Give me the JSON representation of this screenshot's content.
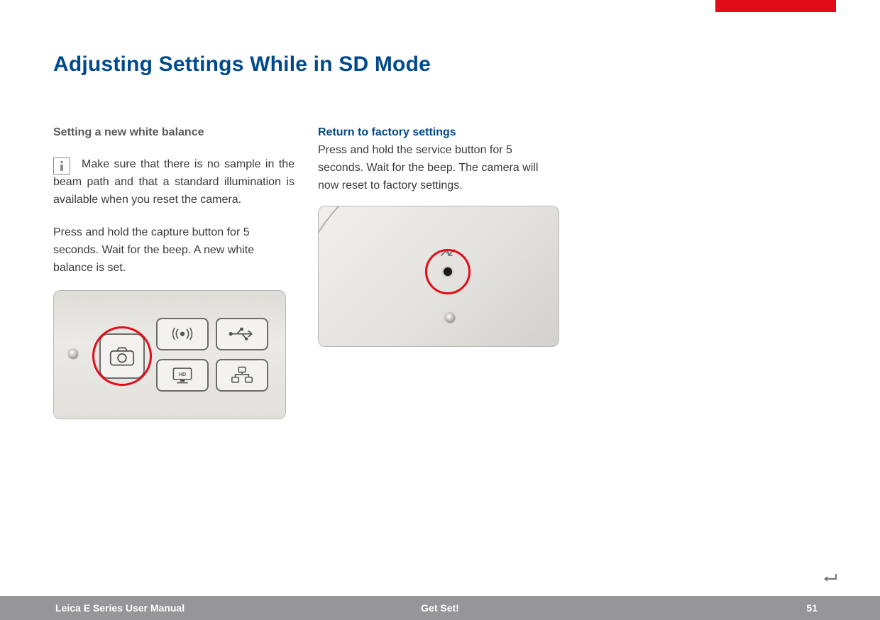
{
  "title": "Adjusting Settings While in SD Mode",
  "left_column": {
    "subhead": "Setting a new white balance",
    "info_text": "Make sure that there is no sample in the beam path and that a standard illumination is available when you reset the camera.",
    "para": "Press and hold the capture button for 5 seconds. Wait for the beep. A new white balance is set.",
    "icons": {
      "info": "info-icon",
      "camera": "camera-icon",
      "wifi": "wifi-icon",
      "usb": "usb-icon",
      "hd_label": "HD",
      "network": "network-icon"
    }
  },
  "right_column": {
    "subhead": "Return to factory settings",
    "para": "Press and hold the service button for 5 seconds. Wait for the beep. The camera will now reset to factory settings."
  },
  "footer": {
    "left": "Leica E Series User Manual",
    "center": "Get Set!",
    "page": "51"
  },
  "colors": {
    "brand_red": "#e20c18",
    "brand_blue": "#004a8b",
    "footer_gray": "#96969a"
  }
}
